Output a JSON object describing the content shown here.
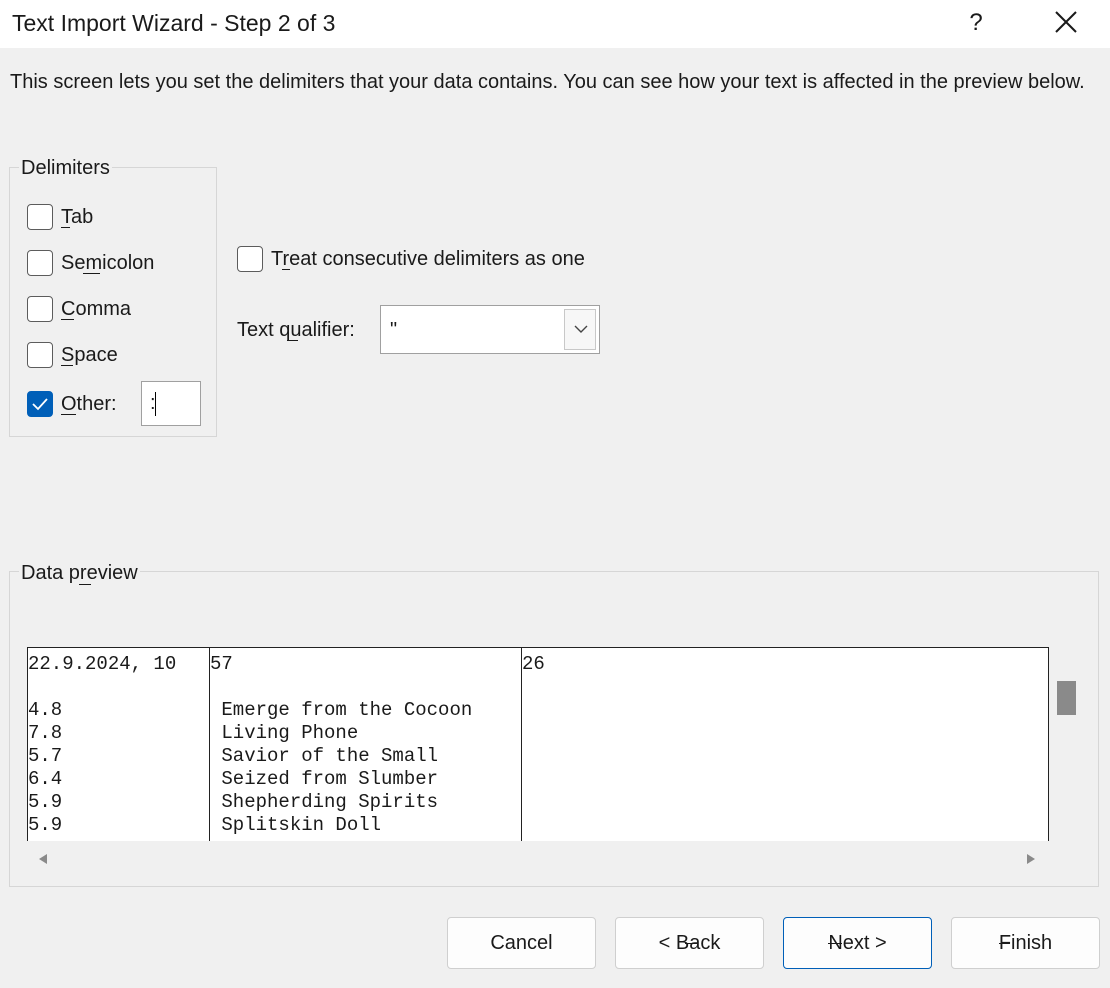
{
  "window": {
    "title": "Text Import Wizard - Step 2 of 3",
    "help_label": "?",
    "close_icon": "close-icon"
  },
  "description": "This screen lets you set the delimiters that your data contains. You can see how your text is affected in the preview below.",
  "delimiters": {
    "group_label": "Delimiters",
    "tab": {
      "label": "Tab",
      "checked": false
    },
    "semicolon": {
      "label": "Semicolon",
      "checked": false
    },
    "comma": {
      "label": "Comma",
      "checked": false
    },
    "space": {
      "label": "Space",
      "checked": false
    },
    "other": {
      "label": "Other:",
      "checked": true,
      "value": ":"
    }
  },
  "options": {
    "consecutive": {
      "label": "Treat consecutive delimiters as one",
      "checked": false
    },
    "text_qualifier_label": "Text qualifier:",
    "text_qualifier_value": "\""
  },
  "preview": {
    "group_label": "Data preview",
    "rows": [
      [
        "22.9.2024, 10",
        "57",
        "26"
      ],
      [
        "",
        "",
        ""
      ],
      [
        "4.8",
        " Emerge from the Cocoon",
        ""
      ],
      [
        "7.8",
        " Living Phone",
        ""
      ],
      [
        "5.7",
        " Savior of the Small",
        ""
      ],
      [
        "6.4",
        " Seized from Slumber",
        ""
      ],
      [
        "5.9",
        " Shepherding Spirits",
        ""
      ],
      [
        "5.9",
        " Splitskin Doll",
        ""
      ]
    ]
  },
  "buttons": {
    "cancel": "Cancel",
    "back": "< Back",
    "next": "Next >",
    "finish": "Finish"
  }
}
